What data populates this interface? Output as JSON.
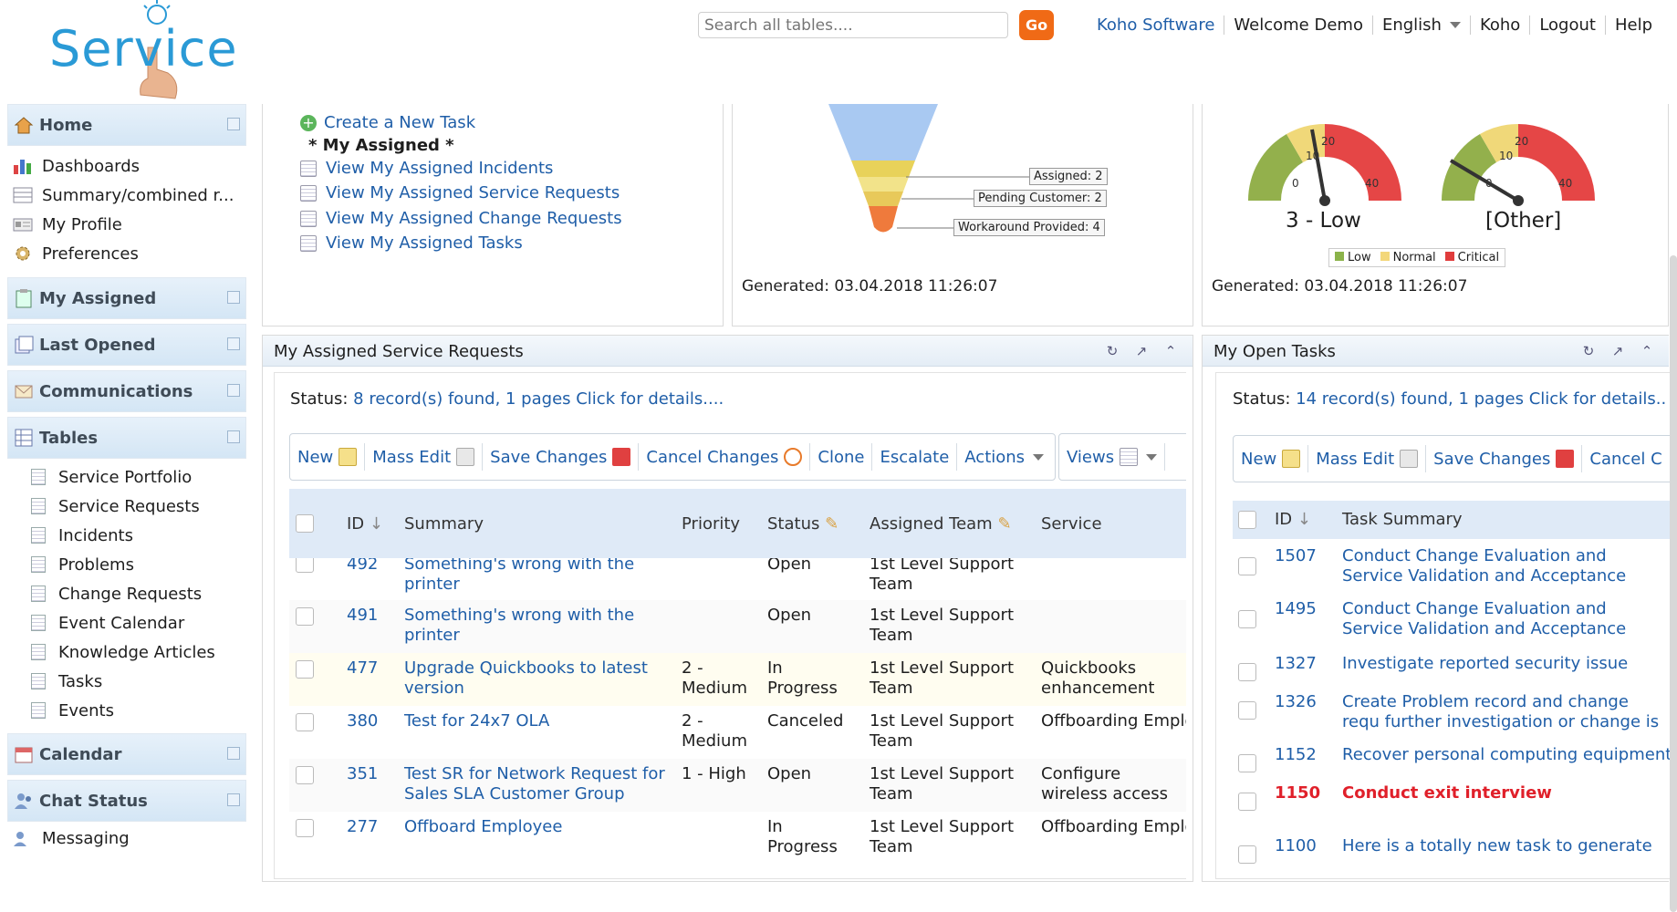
{
  "header": {
    "logo_text": "Service",
    "search_placeholder": "Search all tables....",
    "go_label": "Go",
    "nav": [
      "Koho Software",
      "Welcome Demo",
      "English",
      "Koho",
      "Logout",
      "Help"
    ]
  },
  "sidebar": {
    "home": "Home",
    "home_items": [
      "Dashboards",
      "Summary/combined r...",
      "My Profile",
      "Preferences"
    ],
    "sections": [
      "My Assigned",
      "Last Opened",
      "Communications",
      "Tables"
    ],
    "tables": [
      "Service Portfolio",
      "Service Requests",
      "Incidents",
      "Problems",
      "Change Requests",
      "Event Calendar",
      "Knowledge Articles",
      "Tasks",
      "Events"
    ],
    "calendar": "Calendar",
    "chat": "Chat Status",
    "messaging": "Messaging"
  },
  "links_panel": {
    "create_task": "Create a New Task",
    "my_assigned_heading": "* My Assigned *",
    "links": [
      "View My Assigned Incidents",
      "View My Assigned Service Requests",
      "View My Assigned Change Requests",
      "View My Assigned Tasks"
    ]
  },
  "funnel_panel": {
    "labels": [
      "Assigned: 2",
      "Pending Customer: 2",
      "Workaround Provided: 4"
    ],
    "generated": "Generated: 03.04.2018 11:26:07"
  },
  "gauge_panel": {
    "gauge1_label": "3 - Low",
    "gauge2_label": "[Other]",
    "ticks": [
      "0",
      "10",
      "20",
      "40"
    ],
    "legend": [
      "Low",
      "Normal",
      "Critical"
    ],
    "legend_colors": [
      "#8bb34a",
      "#f3d77a",
      "#e03c3c"
    ],
    "generated": "Generated: 03.04.2018 11:26:07"
  },
  "sr_panel": {
    "title": "My Assigned Service Requests",
    "status_prefix": "Status:",
    "status_text": "8 record(s) found, 1 pages Click for details....",
    "toolbar": [
      "New",
      "Mass Edit",
      "Save Changes",
      "Cancel Changes",
      "Clone",
      "Escalate",
      "Actions",
      "Views"
    ],
    "columns": [
      "ID",
      "Summary",
      "Priority",
      "Status",
      "Assigned Team",
      "Service"
    ],
    "rows": [
      {
        "id": "492",
        "summary": "Something's wrong with the printer",
        "priority": "",
        "status": "Open",
        "team": "1st Level Support Team",
        "service": ""
      },
      {
        "id": "491",
        "summary": "Something's wrong with the printer",
        "priority": "",
        "status": "Open",
        "team": "1st Level Support Team",
        "service": ""
      },
      {
        "id": "477",
        "summary": "Upgrade Quickbooks to latest version",
        "priority": "2 - Medium",
        "status": "In Progress",
        "team": "1st Level Support Team",
        "service": "Quickbooks enhancement"
      },
      {
        "id": "380",
        "summary": "Test for 24x7 OLA",
        "priority": "2 - Medium",
        "status": "Canceled",
        "team": "1st Level Support Team",
        "service": "Offboarding Emplo"
      },
      {
        "id": "351",
        "summary": "Test SR for Network Request for Sales SLA Customer Group",
        "priority": "1 - High",
        "status": "Open",
        "team": "1st Level Support Team",
        "service": "Configure wireless access"
      },
      {
        "id": "277",
        "summary": "Offboard Employee",
        "priority": "",
        "status": "In Progress",
        "team": "1st Level Support Team",
        "service": "Offboarding Emplo"
      }
    ]
  },
  "tasks_panel": {
    "title": "My Open Tasks",
    "status_prefix": "Status:",
    "status_text": "14 record(s) found, 1 pages Click for details..",
    "toolbar": [
      "New",
      "Mass Edit",
      "Save Changes",
      "Cancel C"
    ],
    "columns": [
      "ID",
      "Task Summary"
    ],
    "rows": [
      {
        "id": "1507",
        "summary": "Conduct Change Evaluation and Service Validation and Acceptance",
        "overdue": false
      },
      {
        "id": "1495",
        "summary": "Conduct Change Evaluation and Service Validation and Acceptance",
        "overdue": false
      },
      {
        "id": "1327",
        "summary": "Investigate reported security issue",
        "overdue": false
      },
      {
        "id": "1326",
        "summary": "Create Problem record and change requ further investigation or change is neede",
        "overdue": false
      },
      {
        "id": "1152",
        "summary": "Recover personal computing equipment",
        "overdue": false
      },
      {
        "id": "1150",
        "summary": "Conduct exit interview",
        "overdue": true
      },
      {
        "id": "1100",
        "summary": "Here is a totally new task to generate",
        "overdue": false
      }
    ]
  },
  "colors": {
    "accent": "#1f5ea8",
    "go": "#f06a16",
    "overdue": "#e0202a"
  }
}
